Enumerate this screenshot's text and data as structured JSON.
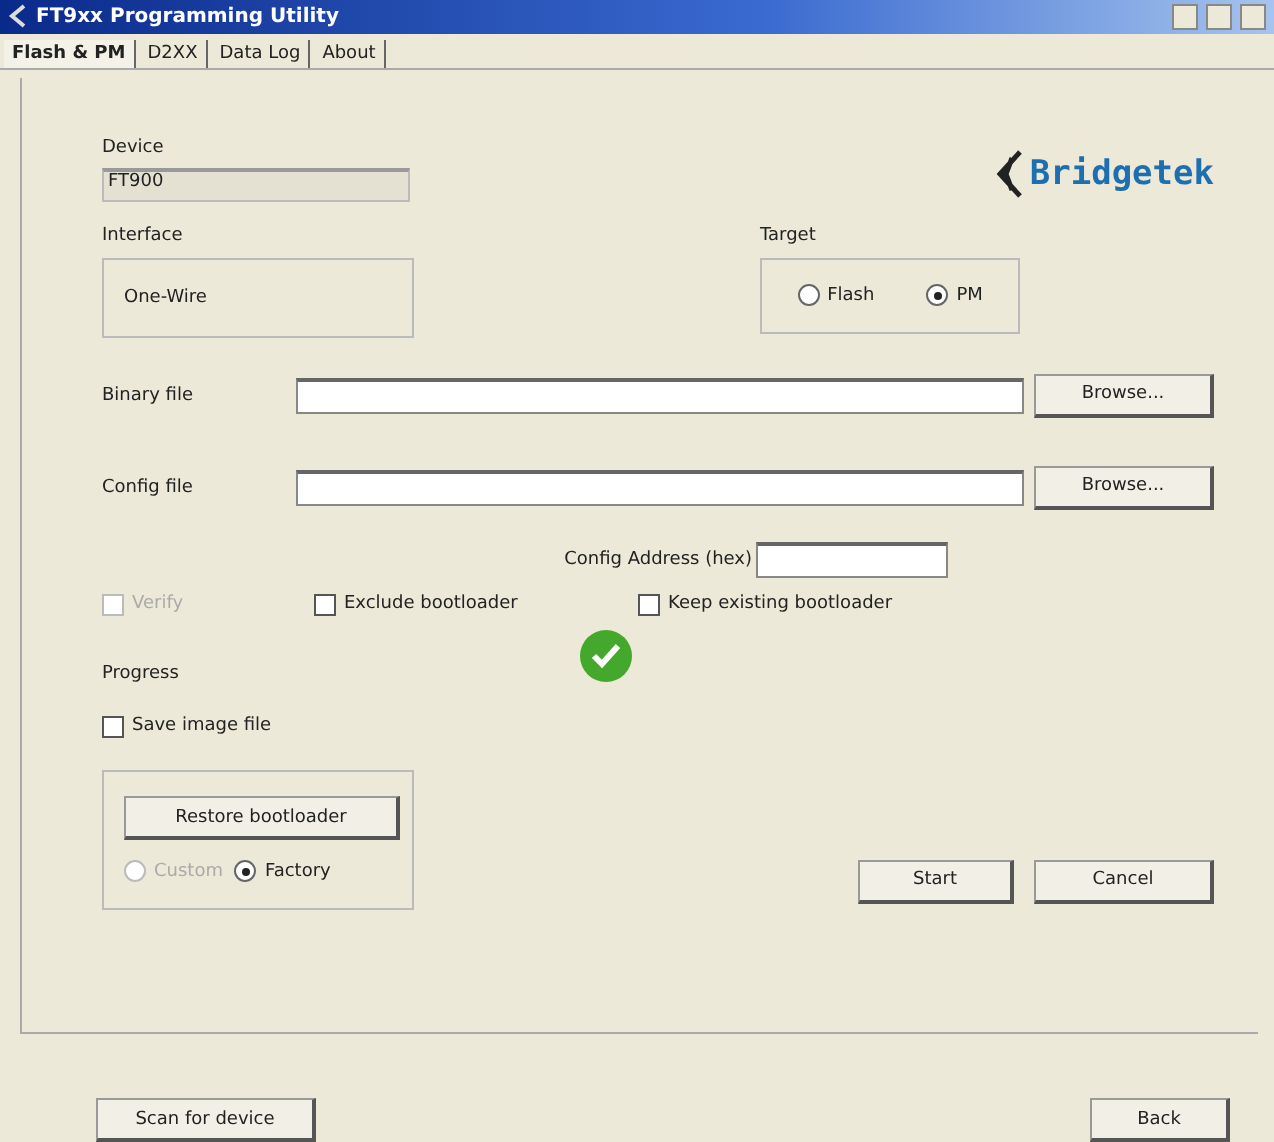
{
  "window": {
    "title": "FT9xx Programming Utility"
  },
  "tabs": [
    {
      "label": "Flash & PM",
      "selected": true
    },
    {
      "label": "D2XX",
      "selected": false
    },
    {
      "label": "Data Log",
      "selected": false
    },
    {
      "label": "About",
      "selected": false
    }
  ],
  "device": {
    "label": "Device",
    "value": "FT900"
  },
  "logo": {
    "text": "Bridgetek"
  },
  "interface": {
    "label": "Interface",
    "value": "One-Wire"
  },
  "target": {
    "label": "Target",
    "options": [
      {
        "label": "Flash",
        "selected": false
      },
      {
        "label": "PM",
        "selected": true
      }
    ]
  },
  "files": [
    {
      "label": "Binary file",
      "button": "Browse..."
    },
    {
      "label": "Config file",
      "button": "Browse..."
    }
  ],
  "config_address": {
    "label": "Config Address (hex)"
  },
  "options": [
    {
      "label": "Verify",
      "checked": false,
      "disabled": true
    },
    {
      "label": "Exclude bootloader",
      "checked": false,
      "disabled": false
    },
    {
      "label": "Keep existing bootloader",
      "checked": false,
      "disabled": false
    }
  ],
  "status": {
    "success": true
  },
  "progress": {
    "label": "Progress"
  },
  "save_image": {
    "label": "Save image file",
    "checked": false
  },
  "restore": {
    "button": "Restore bootloader",
    "options": [
      {
        "label": "Custom",
        "selected": false,
        "disabled": true
      },
      {
        "label": "Factory",
        "selected": true,
        "disabled": false
      }
    ]
  },
  "actions": [
    "Start",
    "Cancel"
  ],
  "footer": {
    "scan": "Scan for device",
    "back": "Back"
  }
}
